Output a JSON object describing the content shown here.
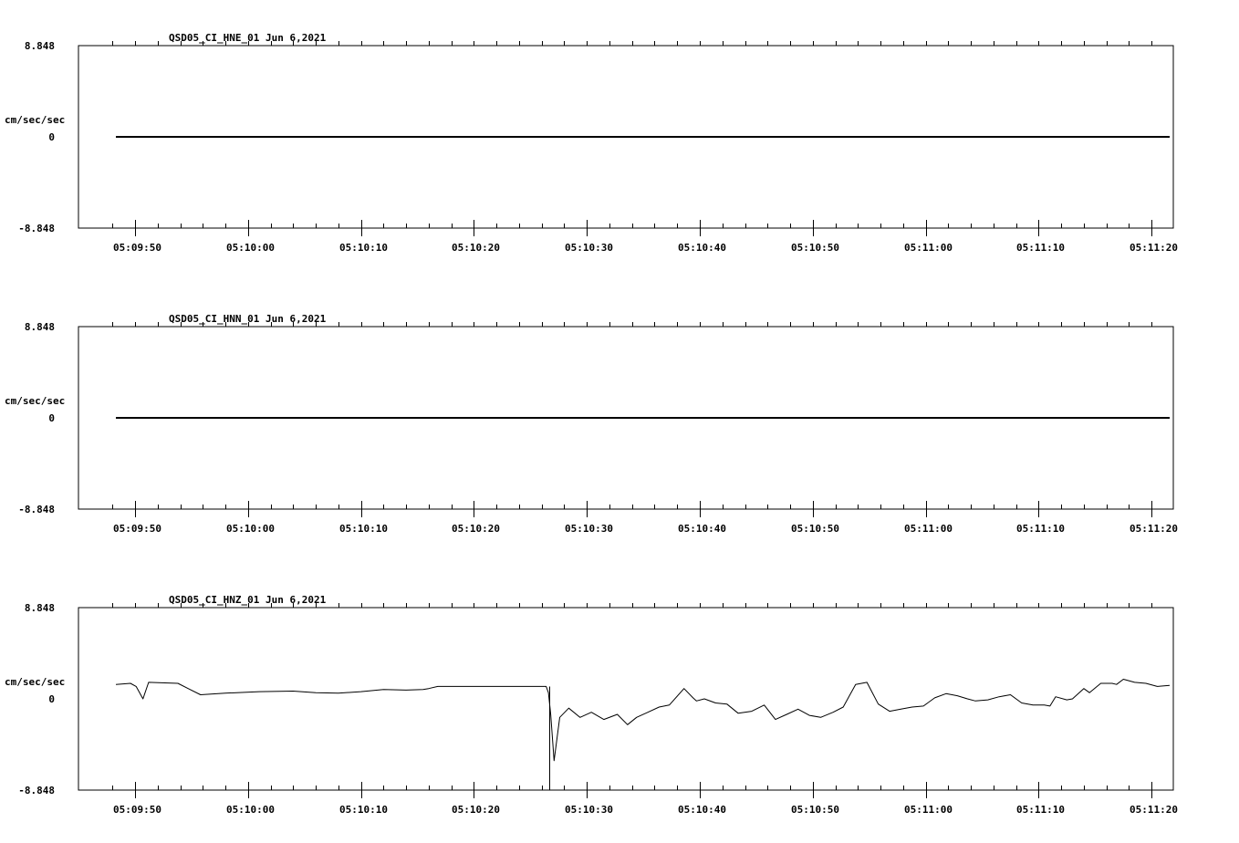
{
  "chart_data": [
    {
      "type": "line",
      "title": "QSD05_CI_HNE_01  Jun 6,2021",
      "ylabel": "cm/sec/sec",
      "ylim": [
        -8.848,
        8.848
      ],
      "y_tick_labels": [
        "8.848",
        "0",
        "-8.848"
      ],
      "x_tick_labels": [
        "05:09:50",
        "05:10:00",
        "05:10:10",
        "05:10:20",
        "05:10:30",
        "05:10:40",
        "05:10:50",
        "05:11:00",
        "05:11:10",
        "05:11:20"
      ],
      "x_range_seconds": [
        -2.5,
        91.6
      ],
      "series": [
        {
          "x": [
            -1.7,
            91.6
          ],
          "values": [
            0,
            0
          ]
        }
      ]
    },
    {
      "type": "line",
      "title": "QSD05_CI_HNN_01  Jun 6,2021",
      "ylabel": "cm/sec/sec",
      "ylim": [
        -8.848,
        8.848
      ],
      "y_tick_labels": [
        "8.848",
        "0",
        "-8.848"
      ],
      "x_tick_labels": [
        "05:09:50",
        "05:10:00",
        "05:10:10",
        "05:10:20",
        "05:10:30",
        "05:10:40",
        "05:10:50",
        "05:11:00",
        "05:11:10",
        "05:11:20"
      ],
      "x_range_seconds": [
        -2.5,
        91.6
      ],
      "series": [
        {
          "x": [
            -1.7,
            91.6
          ],
          "values": [
            0,
            0
          ]
        }
      ]
    },
    {
      "type": "line",
      "title": "QSD05_CI_HNZ_01  Jun 6,2021",
      "ylabel": "cm/sec/sec",
      "ylim": [
        -8.848,
        8.848
      ],
      "y_tick_labels": [
        "8.848",
        "0",
        "-8.848"
      ],
      "x_tick_labels": [
        "05:09:50",
        "05:10:00",
        "05:10:10",
        "05:10:20",
        "05:10:30",
        "05:10:40",
        "05:10:50",
        "05:11:00",
        "05:11:10",
        "05:11:20"
      ],
      "x_range_seconds": [
        -2.5,
        91.6
      ],
      "series": [
        {
          "x": [
            -1.7,
            -0.4,
            0.1,
            0.7,
            1.2,
            3.8,
            4.7,
            5.8,
            8,
            11,
            14,
            16,
            18,
            20,
            22,
            24,
            25.5,
            26,
            26.8,
            36.4,
            36.6,
            36.8,
            37.1,
            37.6,
            38.4,
            39.4,
            40.4,
            41.5,
            42.7,
            43.6,
            44.4,
            45.4,
            46.4,
            47.3,
            48.6,
            49.4,
            49.7,
            50.4,
            51.4,
            52.4,
            53.4,
            54.6,
            55.7,
            56.7,
            57.7,
            58.7,
            59.7,
            60.7,
            61.8,
            62.7,
            63.8,
            64.8,
            65.8,
            66.8,
            67.8,
            68.8,
            69.8,
            70.8,
            71.8,
            72.8,
            73.7,
            74.4,
            75.5,
            76.5,
            77.5,
            78.5,
            79.5,
            80.5,
            81,
            81.5,
            82.5,
            83,
            84,
            84.5,
            85.5,
            86.5,
            86.9,
            87.5,
            88.5,
            89.5,
            90.5,
            91.6
          ],
          "values": [
            1.4,
            1.5,
            1.2,
            0.0,
            1.6,
            1.5,
            1.0,
            0.4,
            0.55,
            0.7,
            0.75,
            0.6,
            0.55,
            0.7,
            0.9,
            0.85,
            0.9,
            1.0,
            1.2,
            1.2,
            0.6,
            -1.5,
            -6.0,
            -1.8,
            -0.9,
            -1.8,
            -1.3,
            -2.0,
            -1.5,
            -2.5,
            -1.8,
            -1.3,
            -0.8,
            -0.6,
            1.0,
            0.1,
            -0.2,
            0.0,
            -0.4,
            -0.5,
            -1.4,
            -1.2,
            -0.6,
            -2.0,
            -1.5,
            -1.0,
            -1.6,
            -1.8,
            -1.3,
            -0.8,
            1.4,
            1.6,
            -0.5,
            -1.2,
            -1.0,
            -0.8,
            -0.7,
            0.1,
            0.5,
            0.3,
            0.0,
            -0.2,
            -0.1,
            0.2,
            0.4,
            -0.4,
            -0.6,
            -0.6,
            -0.7,
            0.2,
            -0.1,
            0.0,
            1.0,
            0.6,
            1.5,
            1.5,
            1.4,
            1.9,
            1.6,
            1.5,
            1.2,
            1.3
          ]
        }
      ]
    }
  ]
}
